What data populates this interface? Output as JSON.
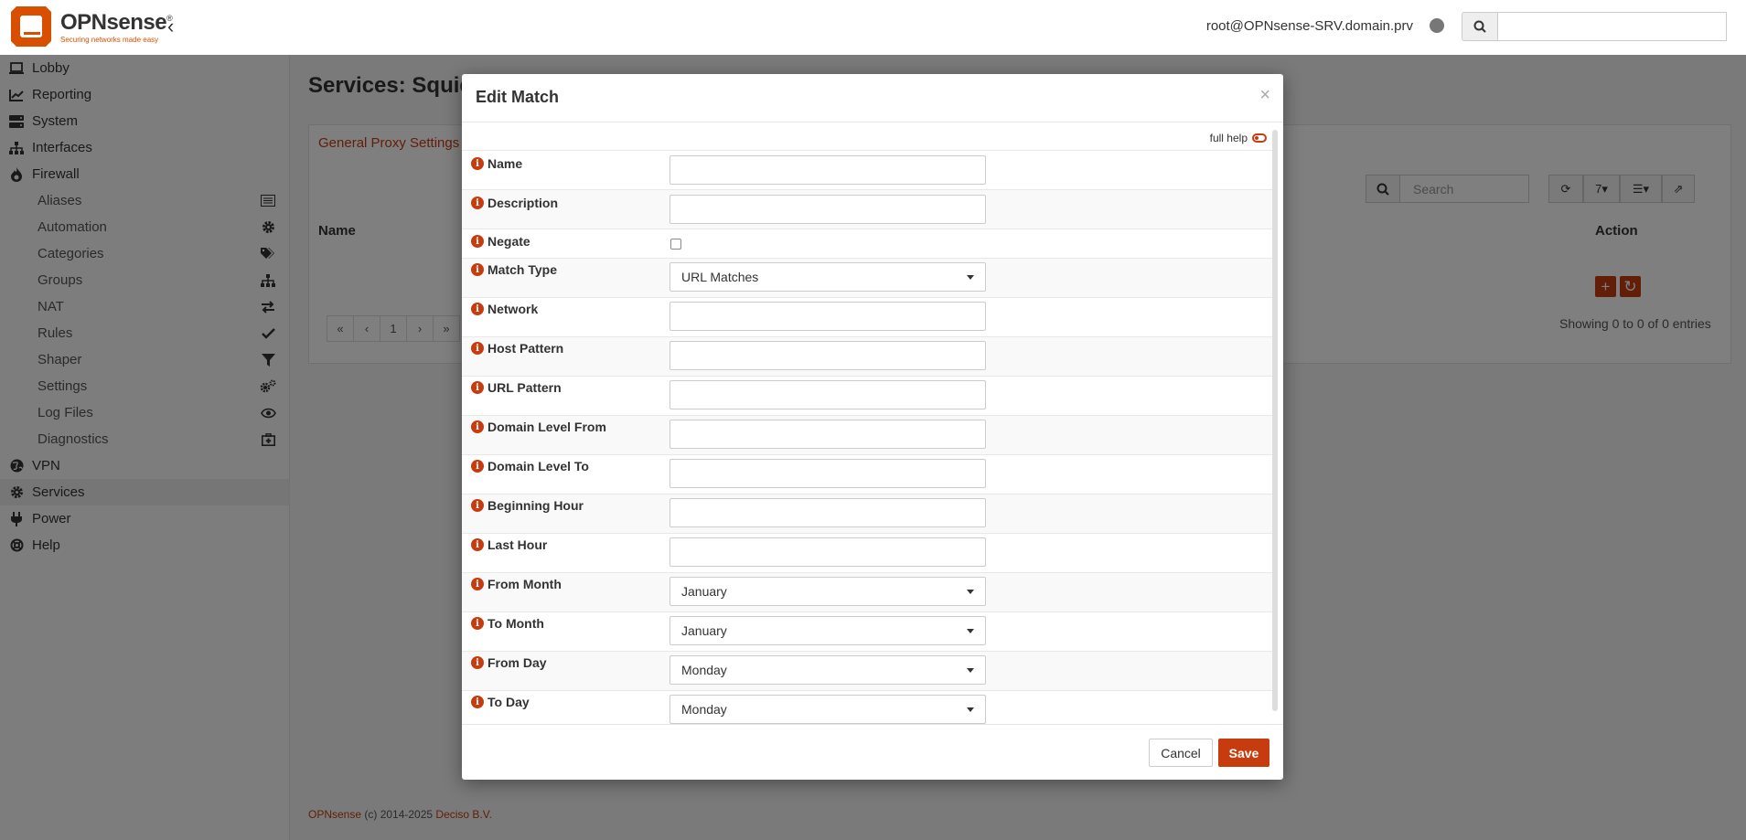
{
  "header": {
    "logo_text": "OPNsense",
    "logo_mark": "®",
    "logo_tagline": "Securing networks made easy",
    "user": "root@OPNsense-SRV.domain.prv",
    "search_placeholder": ""
  },
  "sidebar": {
    "items": [
      {
        "label": "Lobby",
        "icon": "laptop-icon"
      },
      {
        "label": "Reporting",
        "icon": "chart-icon"
      },
      {
        "label": "System",
        "icon": "server-icon"
      },
      {
        "label": "Interfaces",
        "icon": "sitemap-icon"
      },
      {
        "label": "Firewall",
        "icon": "fire-icon"
      },
      {
        "label": "VPN",
        "icon": "globe-icon"
      },
      {
        "label": "Services",
        "icon": "gear-icon"
      },
      {
        "label": "Power",
        "icon": "plug-icon"
      },
      {
        "label": "Help",
        "icon": "lifebuoy-icon"
      }
    ],
    "firewall_sub": [
      {
        "label": "Aliases",
        "icon": "list-icon"
      },
      {
        "label": "Automation",
        "icon": "gear-icon"
      },
      {
        "label": "Categories",
        "icon": "tags-icon"
      },
      {
        "label": "Groups",
        "icon": "sitemap-icon"
      },
      {
        "label": "NAT",
        "icon": "exchange-icon"
      },
      {
        "label": "Rules",
        "icon": "check-icon"
      },
      {
        "label": "Shaper",
        "icon": "filter-icon"
      },
      {
        "label": "Settings",
        "icon": "gears-icon"
      },
      {
        "label": "Log Files",
        "icon": "eye-icon"
      },
      {
        "label": "Diagnostics",
        "icon": "medkit-icon"
      }
    ]
  },
  "page": {
    "title": "Services: Squid",
    "tab": "General Proxy Settings",
    "grid_search_placeholder": "Search",
    "page_size": "7",
    "col_name": "Name",
    "col_action": "Action",
    "showing": "Showing 0 to 0 of 0 entries",
    "pager": [
      "«",
      "‹",
      "1",
      "›",
      "»"
    ]
  },
  "footer": {
    "brand": "OPNsense",
    "copyright": " (c) 2014-2025 ",
    "company": "Deciso B.V."
  },
  "modal": {
    "title": "Edit Match",
    "close": "×",
    "full_help": "full help",
    "fields": {
      "name": "Name",
      "description": "Description",
      "negate": "Negate",
      "match_type": "Match Type",
      "match_type_value": "URL Matches",
      "network": "Network",
      "host_pattern": "Host Pattern",
      "url_pattern": "URL Pattern",
      "domain_level_from": "Domain Level From",
      "domain_level_to": "Domain Level To",
      "beginning_hour": "Beginning Hour",
      "last_hour": "Last Hour",
      "from_month": "From Month",
      "from_month_value": "January",
      "to_month": "To Month",
      "to_month_value": "January",
      "from_day": "From Day",
      "from_day_value": "Monday",
      "to_day": "To Day",
      "to_day_value": "Monday"
    },
    "cancel": "Cancel",
    "save": "Save"
  },
  "colors": {
    "accent": "#c63c0f",
    "overlay": "rgba(0,0,0,0.5)"
  }
}
